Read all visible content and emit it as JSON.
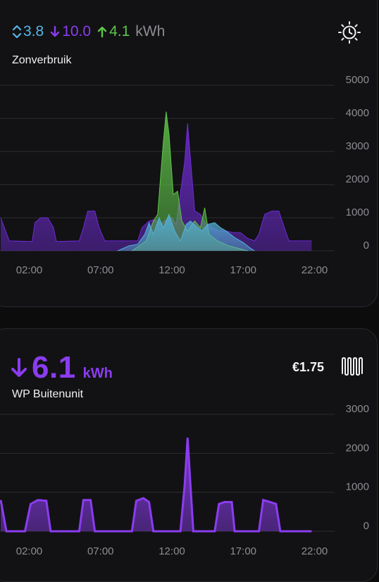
{
  "solar_card": {
    "stats": [
      {
        "icon": "bidirectional-arrow-icon",
        "value": "3.8",
        "color": "#57b6e6"
      },
      {
        "icon": "arrow-down-icon",
        "value": "10.0",
        "color": "#8b3cf0"
      },
      {
        "icon": "arrow-up-icon",
        "value": "4.1",
        "color": "#5fc449"
      }
    ],
    "unit": "kWh",
    "title": "Zonverbruik",
    "settings_icon": "sun-clock-icon",
    "chart_data": {
      "type": "area",
      "x_tick_labels": [
        "02:00",
        "07:00",
        "12:00",
        "17:00",
        "22:00"
      ],
      "y_tick_labels": [
        "0",
        "1000",
        "2000",
        "3000",
        "4000",
        "5000"
      ],
      "ylim": [
        0,
        5000
      ],
      "xlim_hours": [
        0,
        24
      ],
      "grid": true,
      "series": [
        {
          "color": "#6f2bd6",
          "points": [
            [
              0,
              1000
            ],
            [
              0.6,
              300
            ],
            [
              2.2,
              280
            ],
            [
              2.4,
              850
            ],
            [
              2.8,
              1000
            ],
            [
              3.3,
              1000
            ],
            [
              3.7,
              700
            ],
            [
              3.9,
              280
            ],
            [
              5.5,
              300
            ],
            [
              5.8,
              700
            ],
            [
              6.1,
              1200
            ],
            [
              6.6,
              1200
            ],
            [
              6.9,
              700
            ],
            [
              7.3,
              300
            ],
            [
              9.6,
              300
            ],
            [
              9.9,
              700
            ],
            [
              10.4,
              900
            ],
            [
              10.8,
              950
            ],
            [
              11.2,
              800
            ],
            [
              11.6,
              950
            ],
            [
              12.0,
              1000
            ],
            [
              12.3,
              800
            ],
            [
              12.9,
              2700
            ],
            [
              13.1,
              3850
            ],
            [
              13.3,
              2800
            ],
            [
              13.6,
              1200
            ],
            [
              14.0,
              1100
            ],
            [
              14.4,
              800
            ],
            [
              14.8,
              700
            ],
            [
              15.3,
              600
            ],
            [
              15.8,
              600
            ],
            [
              16.3,
              550
            ],
            [
              16.8,
              550
            ],
            [
              17.3,
              380
            ],
            [
              17.8,
              300
            ],
            [
              18.1,
              500
            ],
            [
              18.5,
              1100
            ],
            [
              19.0,
              1200
            ],
            [
              19.5,
              1200
            ],
            [
              19.8,
              800
            ],
            [
              20.2,
              300
            ],
            [
              21.8,
              300
            ]
          ]
        },
        {
          "color": "#5fc449",
          "points": [
            [
              9.2,
              0
            ],
            [
              10.2,
              300
            ],
            [
              10.7,
              900
            ],
            [
              11.0,
              1100
            ],
            [
              11.4,
              3300
            ],
            [
              11.6,
              4200
            ],
            [
              11.8,
              3500
            ],
            [
              12.1,
              1700
            ],
            [
              12.4,
              1800
            ],
            [
              12.7,
              900
            ],
            [
              13.1,
              600
            ],
            [
              13.6,
              900
            ],
            [
              14.0,
              700
            ],
            [
              14.3,
              1300
            ],
            [
              14.6,
              500
            ],
            [
              15.2,
              300
            ],
            [
              16.0,
              150
            ],
            [
              17.3,
              0
            ]
          ]
        },
        {
          "color": "#52b0d6",
          "points": [
            [
              8.2,
              0
            ],
            [
              9.0,
              150
            ],
            [
              9.6,
              200
            ],
            [
              10.1,
              500
            ],
            [
              10.4,
              850
            ],
            [
              10.7,
              500
            ],
            [
              11.1,
              1000
            ],
            [
              11.4,
              700
            ],
            [
              11.8,
              1100
            ],
            [
              12.2,
              600
            ],
            [
              12.6,
              300
            ],
            [
              13.0,
              800
            ],
            [
              13.3,
              900
            ],
            [
              13.7,
              750
            ],
            [
              14.1,
              600
            ],
            [
              14.5,
              800
            ],
            [
              15.0,
              850
            ],
            [
              15.4,
              700
            ],
            [
              15.8,
              600
            ],
            [
              16.4,
              400
            ],
            [
              17.0,
              250
            ],
            [
              17.5,
              80
            ],
            [
              17.8,
              0
            ]
          ]
        }
      ]
    }
  },
  "wp_card": {
    "value": "6.1",
    "unit": "kWh",
    "arrow_icon": "arrow-down-icon",
    "title": "WP Buitenunit",
    "price": "€1.75",
    "device_icon": "radiator-icon",
    "chart_data": {
      "type": "area",
      "x_tick_labels": [
        "02:00",
        "07:00",
        "12:00",
        "17:00",
        "22:00"
      ],
      "y_tick_labels": [
        "0",
        "1000",
        "2000",
        "3000"
      ],
      "ylim": [
        0,
        3000
      ],
      "xlim_hours": [
        0,
        24
      ],
      "grid": true,
      "series": [
        {
          "color": "#8b3cf0",
          "points": [
            [
              0,
              800
            ],
            [
              0.4,
              0
            ],
            [
              1.7,
              0
            ],
            [
              2.1,
              700
            ],
            [
              2.6,
              800
            ],
            [
              3.2,
              780
            ],
            [
              3.5,
              0
            ],
            [
              5.5,
              0
            ],
            [
              5.8,
              800
            ],
            [
              6.3,
              800
            ],
            [
              6.6,
              0
            ],
            [
              9.2,
              0
            ],
            [
              9.5,
              780
            ],
            [
              10.0,
              850
            ],
            [
              10.4,
              750
            ],
            [
              10.7,
              0
            ],
            [
              12.6,
              0
            ],
            [
              12.9,
              1200
            ],
            [
              13.1,
              2400
            ],
            [
              13.3,
              1200
            ],
            [
              13.5,
              0
            ],
            [
              15.0,
              0
            ],
            [
              15.3,
              700
            ],
            [
              15.7,
              750
            ],
            [
              16.2,
              750
            ],
            [
              16.4,
              0
            ],
            [
              18.1,
              0
            ],
            [
              18.4,
              800
            ],
            [
              18.9,
              750
            ],
            [
              19.3,
              700
            ],
            [
              19.6,
              0
            ],
            [
              21.8,
              0
            ]
          ]
        }
      ]
    }
  }
}
